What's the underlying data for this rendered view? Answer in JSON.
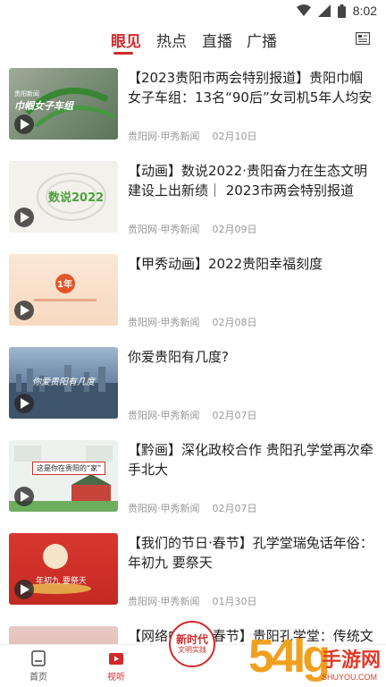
{
  "status_bar": {
    "time": "8:02"
  },
  "tabs": [
    {
      "label": "眼见",
      "active": true
    },
    {
      "label": "热点",
      "active": false
    },
    {
      "label": "直播",
      "active": false
    },
    {
      "label": "广播",
      "active": false
    }
  ],
  "feed": [
    {
      "title": "【2023贵阳市两会特别报道】贵阳巾帼女子车组：13名“90后”女司机5年人均安全…",
      "source": "贵阳网·甲秀新闻",
      "date": "02月10日",
      "thumb_text": "巾帼女子车组",
      "thumb_caption": "贵阳新闻"
    },
    {
      "title": "【动画】数说2022·贵阳奋力在生态文明建设上出新绩｜ 2023市两会特别报道",
      "source": "贵阳网·甲秀新闻",
      "date": "02月09日",
      "thumb_text": "数说2022"
    },
    {
      "title": "【甲秀动画】2022贵阳幸福刻度",
      "source": "贵阳网·甲秀新闻",
      "date": "02月08日",
      "thumb_text": "1年"
    },
    {
      "title": "你爱贵阳有几度?",
      "source": "贵阳网·甲秀新闻",
      "date": "02月07日",
      "thumb_text": "你爱贵阳有几度"
    },
    {
      "title": "【黔画】深化政校合作 贵阳孔学堂再次牵手北大",
      "source": "贵阳网·甲秀新闻",
      "date": "02月07日",
      "thumb_text": "这是你在贵阳的“家”"
    },
    {
      "title": "【我们的节日·春节】孔学堂瑞兔话年俗：年初九 要祭天",
      "source": "贵阳网·甲秀新闻",
      "date": "01月30日",
      "thumb_text": "年初九 要祭天"
    },
    {
      "title": "【网络中国节·春节】贵阳孔学堂：传统文化中体验有趣的“年”",
      "source": "",
      "date": "",
      "thumb_text": ""
    }
  ],
  "bottom_nav": {
    "home_label": "首页",
    "video_label": "视听",
    "center_line1": "新时代",
    "center_line2": "文明实践"
  },
  "watermark": {
    "number": "54lg",
    "text": "手游网",
    "url": "SHUYOU.COM"
  },
  "colors": {
    "accent": "#d22a2a",
    "meta": "#999999"
  }
}
